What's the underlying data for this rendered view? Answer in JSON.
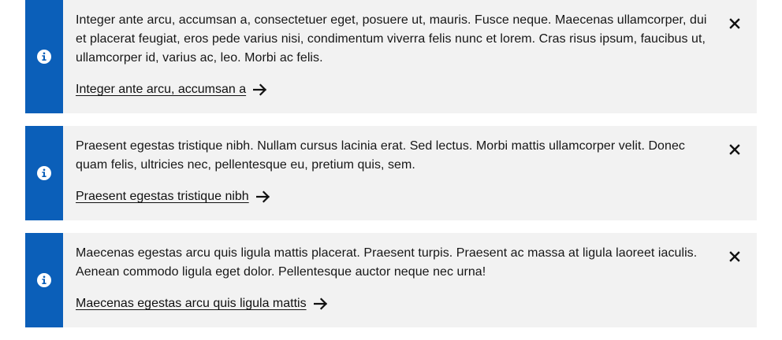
{
  "notifications": [
    {
      "message": "Integer ante arcu, accumsan a, consectetuer eget, posuere ut, mauris. Fusce neque. Maecenas ullamcorper, dui et placerat feugiat, eros pede varius nisi, condimentum viverra felis nunc et lorem. Cras risus ipsum, faucibus ut, ullamcorper id, varius ac, leo. Morbi ac felis.",
      "link_label": "Integer ante arcu, accumsan a",
      "icon": "info-icon",
      "dismiss_icon": "close-icon",
      "action_icon": "arrow-right-icon"
    },
    {
      "message": "Praesent egestas tristique nibh. Nullam cursus lacinia erat. Sed lectus. Morbi mattis ullamcorper velit. Donec quam felis, ultricies nec, pellentesque eu, pretium quis, sem.",
      "link_label": "Praesent egestas tristique nibh",
      "icon": "info-icon",
      "dismiss_icon": "close-icon",
      "action_icon": "arrow-right-icon"
    },
    {
      "message": "Maecenas egestas arcu quis ligula mattis placerat. Praesent turpis. Praesent ac massa at ligula laoreet iaculis. Aenean commodo ligula eget dolor. Pellentesque auctor neque nec urna!",
      "link_label": "Maecenas egestas arcu quis ligula mattis",
      "icon": "info-icon",
      "dismiss_icon": "close-icon",
      "action_icon": "arrow-right-icon"
    }
  ],
  "colors": {
    "accent": "#0b5fb9",
    "panel": "#f2f2f2",
    "text": "#161616"
  }
}
